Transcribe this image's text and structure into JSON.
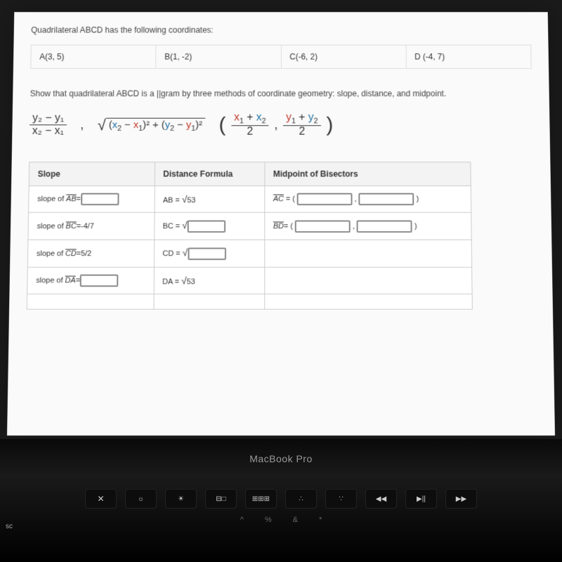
{
  "question": "Quadrilateral ABCD has the following coordinates:",
  "coords": {
    "a": "A(3, 5)",
    "b": "B(1, -2)",
    "c": "C(-6, 2)",
    "d": "D (-4, 7)"
  },
  "instruction": "Show that quadrilateral ABCD is a ||gram by three methods of coordinate geometry: slope, distance, and midpoint.",
  "formula": {
    "slope_num": "y₂ − y₁",
    "slope_den": "x₂ − x₁",
    "comma1": ",",
    "dist_inner": "(x₂ − x₁)² + (y₂ − y₁)²",
    "mid_x_num": "x₁ + x₂",
    "mid_x_den": "2",
    "mid_comma": ",",
    "mid_y_num": "y₁ + y₂",
    "mid_y_den": "2"
  },
  "table": {
    "headers": {
      "slope": "Slope",
      "dist": "Distance Formula",
      "mid": "Midpoint of Bisectors"
    },
    "rows": [
      {
        "slope_label": "slope of ",
        "slope_seg": "AB",
        "slope_eq": "=",
        "slope_val_input": true,
        "dist_label": "AB = ",
        "dist_radicand": "53",
        "mid_seg": "AC",
        "mid_eq": " = (",
        "mid_close": ")"
      },
      {
        "slope_label": "slope of ",
        "slope_seg": "BC",
        "slope_eq": "=-4/7",
        "dist_label": "BC = ",
        "dist_input": true,
        "mid_seg": "BD",
        "mid_eq": "= (",
        "mid_close": ")"
      },
      {
        "slope_label": "slope of ",
        "slope_seg": "CD",
        "slope_eq": "=5/2",
        "dist_label": "CD = ",
        "dist_input": true
      },
      {
        "slope_label": "slope of ",
        "slope_seg": "DA",
        "slope_eq": "=",
        "slope_val_input": true,
        "dist_label": "DA = ",
        "dist_radicand": "53"
      }
    ]
  },
  "laptop": {
    "label": "MacBook Pro",
    "sc": "sc",
    "keys": {
      "close": "✕",
      "bright_down": "☼",
      "bright_up": "☀",
      "mission": "⊟□",
      "launch": "⊞⊞⊞",
      "dots1": "∴",
      "dots2": "∵",
      "prev": "◀◀",
      "play": "▶||",
      "next": "▶▶"
    },
    "bottom": {
      "caret": "^",
      "pct": "%",
      "amp": "&",
      "star": "*"
    }
  }
}
